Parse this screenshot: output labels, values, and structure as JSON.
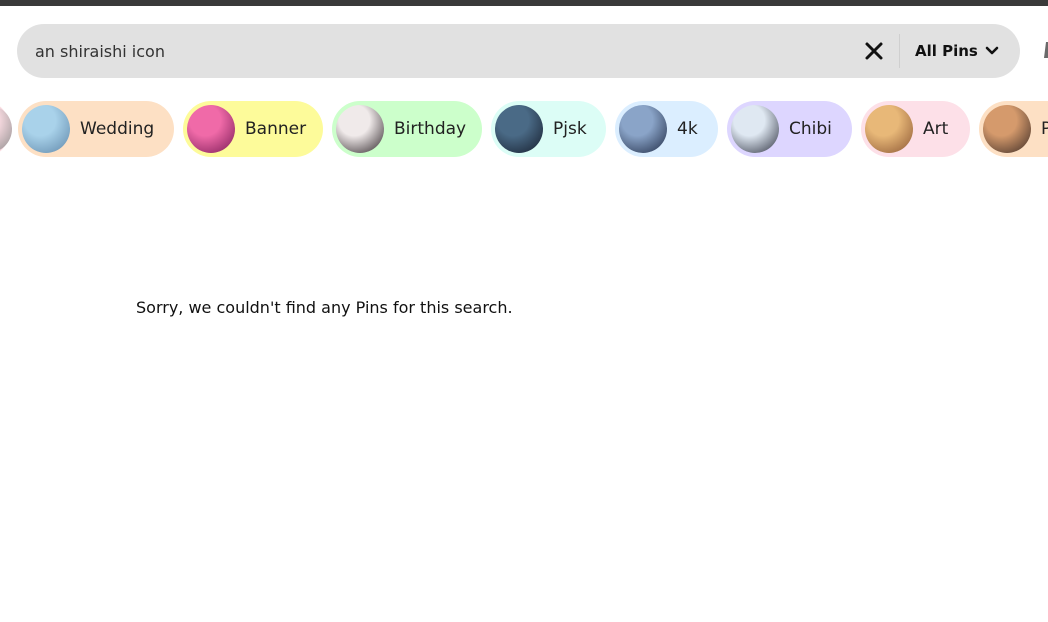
{
  "search": {
    "query": "an shiraishi icon",
    "filter_label": "All Pins",
    "clear_icon": "close-icon",
    "filter_icon": "chevron-down-icon"
  },
  "chips": [
    {
      "label": "",
      "bg": "#fbdde3"
    },
    {
      "label": "Wedding",
      "bg": "#fde0c4",
      "av1": "#a9d2ea",
      "av2": "#5e86a8"
    },
    {
      "label": "Banner",
      "bg": "#fdfb9a",
      "av1": "#f06aa8",
      "av2": "#7a1a55"
    },
    {
      "label": "Birthday",
      "bg": "#ccffcb",
      "av1": "#f0eaea",
      "av2": "#2b2226"
    },
    {
      "label": "Pjsk",
      "bg": "#dcfdf6",
      "av1": "#4a6a86",
      "av2": "#151d2c"
    },
    {
      "label": "4k",
      "bg": "#dbeeff",
      "av1": "#8aa4c8",
      "av2": "#1e2a44"
    },
    {
      "label": "Chibi",
      "bg": "#ddd6ff",
      "av1": "#dfe8f2",
      "av2": "#2b2f3e"
    },
    {
      "label": "Art",
      "bg": "#fde0e8",
      "av1": "#e8b878",
      "av2": "#8a5532"
    },
    {
      "label": "P",
      "bg": "#fde0c4",
      "av1": "#d59a6c",
      "av2": "#3a2a24"
    }
  ],
  "results": {
    "empty_message": "Sorry, we couldn't find any Pins for this search."
  }
}
